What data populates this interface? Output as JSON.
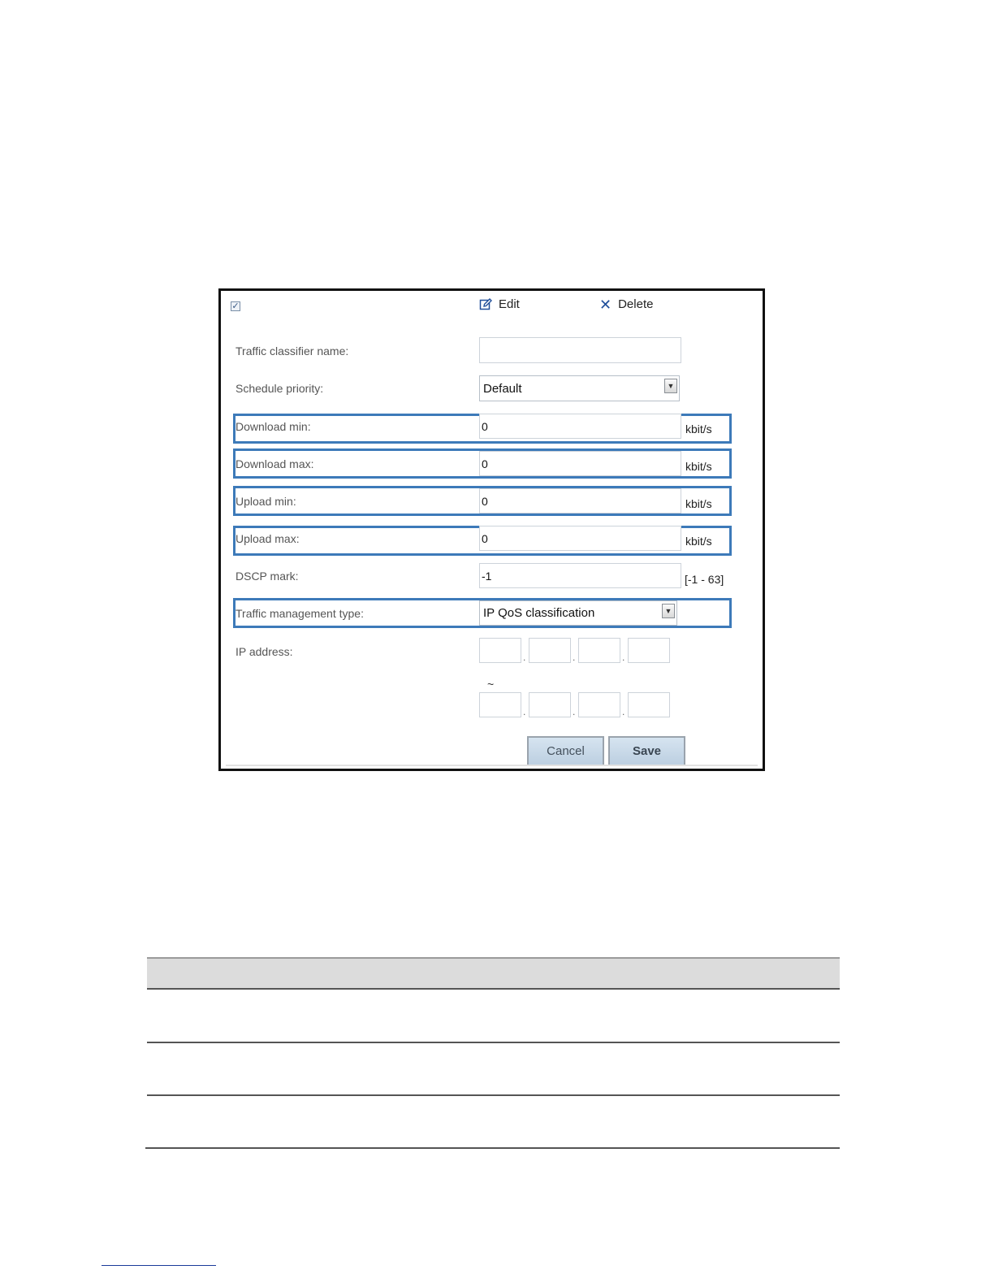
{
  "toolbar": {
    "edit_label": "Edit",
    "delete_label": "Delete",
    "checkbox_mark": "✓"
  },
  "form": {
    "classifier_name": {
      "label": "Traffic classifier name:",
      "value": ""
    },
    "schedule_priority": {
      "label": "Schedule priority:",
      "value": "Default"
    },
    "download_min": {
      "label": "Download min:",
      "value": "0",
      "unit": "kbit/s"
    },
    "download_max": {
      "label": "Download max:",
      "value": "0",
      "unit": "kbit/s"
    },
    "upload_min": {
      "label": "Upload min:",
      "value": "0",
      "unit": "kbit/s"
    },
    "upload_max": {
      "label": "Upload max:",
      "value": "0",
      "unit": "kbit/s"
    },
    "dscp_mark": {
      "label": "DSCP mark:",
      "value": "-1",
      "range": "[-1 - 63]"
    },
    "traffic_management_type": {
      "label": "Traffic management type:",
      "value": "IP QoS classification"
    },
    "ip_address": {
      "label": "IP address:",
      "separator": ".",
      "range_sep": "~"
    }
  },
  "buttons": {
    "cancel": "Cancel",
    "save": "Save"
  },
  "icons": {
    "edit": "edit-icon",
    "delete": "close-icon",
    "dropdown": "chevron-down-icon"
  },
  "colors": {
    "highlight": "#3d7ab9",
    "button": "#c8d9e9"
  }
}
